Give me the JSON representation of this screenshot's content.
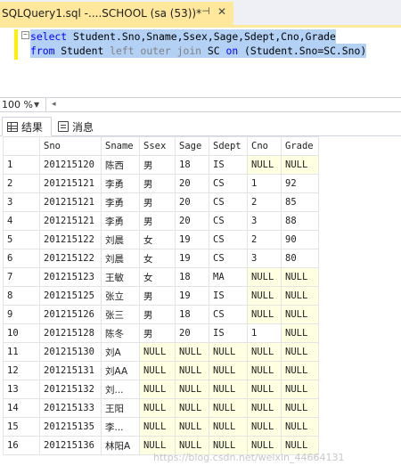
{
  "tab": {
    "title": "SQLQuery1.sql -....SCHOOL (sa (53))*",
    "pin_glyph": "⊣",
    "close_glyph": "✕"
  },
  "editor": {
    "line1": {
      "kw": "select",
      "rest": " Student.Sno,Sname,Ssex,Sage,Sdept,Cno,Grade"
    },
    "line2": {
      "kw1": "from",
      "ident1": " Student ",
      "join": "left outer join",
      "ident2": " SC ",
      "kw2": "on",
      "cond": " (Student.Sno=SC.Sno)"
    }
  },
  "zoom": {
    "value": "100 %"
  },
  "results_tabs": [
    {
      "label": "结果",
      "icon": "grid-icon"
    },
    {
      "label": "消息",
      "icon": "message-icon"
    }
  ],
  "grid": {
    "columns": [
      "Sno",
      "Sname",
      "Ssex",
      "Sage",
      "Sdept",
      "Cno",
      "Grade"
    ],
    "rows": [
      [
        "1",
        "201215120",
        "陈西",
        "男",
        "18",
        "IS",
        "NULL",
        "NULL"
      ],
      [
        "2",
        "201215121",
        "李勇",
        "男",
        "20",
        "CS",
        "1",
        "92"
      ],
      [
        "3",
        "201215121",
        "李勇",
        "男",
        "20",
        "CS",
        "2",
        "85"
      ],
      [
        "4",
        "201215121",
        "李勇",
        "男",
        "20",
        "CS",
        "3",
        "88"
      ],
      [
        "5",
        "201215122",
        "刘晨",
        "女",
        "19",
        "CS",
        "2",
        "90"
      ],
      [
        "6",
        "201215122",
        "刘晨",
        "女",
        "19",
        "CS",
        "3",
        "80"
      ],
      [
        "7",
        "201215123",
        "王敏",
        "女",
        "18",
        "MA",
        "NULL",
        "NULL"
      ],
      [
        "8",
        "201215125",
        "张立",
        "男",
        "19",
        "IS",
        "NULL",
        "NULL"
      ],
      [
        "9",
        "201215126",
        "张三",
        "男",
        "18",
        "CS",
        "NULL",
        "NULL"
      ],
      [
        "10",
        "201215128",
        "陈冬",
        "男",
        "20",
        "IS",
        "1",
        "NULL"
      ],
      [
        "11",
        "201215130",
        "刘A",
        "NULL",
        "NULL",
        "NULL",
        "NULL",
        "NULL"
      ],
      [
        "12",
        "201215131",
        "刘AA",
        "NULL",
        "NULL",
        "NULL",
        "NULL",
        "NULL"
      ],
      [
        "13",
        "201215132",
        "刘...",
        "NULL",
        "NULL",
        "NULL",
        "NULL",
        "NULL"
      ],
      [
        "14",
        "201215133",
        "王阳",
        "NULL",
        "NULL",
        "NULL",
        "NULL",
        "NULL"
      ],
      [
        "15",
        "201215135",
        "李...",
        "NULL",
        "NULL",
        "NULL",
        "NULL",
        "NULL"
      ],
      [
        "16",
        "201215136",
        "林阳A",
        "NULL",
        "NULL",
        "NULL",
        "NULL",
        "NULL"
      ]
    ]
  },
  "watermark": "https://blog.csdn.net/weixin_44664131",
  "colors": {
    "tab_active": "#ffe89c",
    "selection": "#b3d1f4",
    "null_cell": "#ffffe1",
    "keyword": "#0000ff"
  }
}
